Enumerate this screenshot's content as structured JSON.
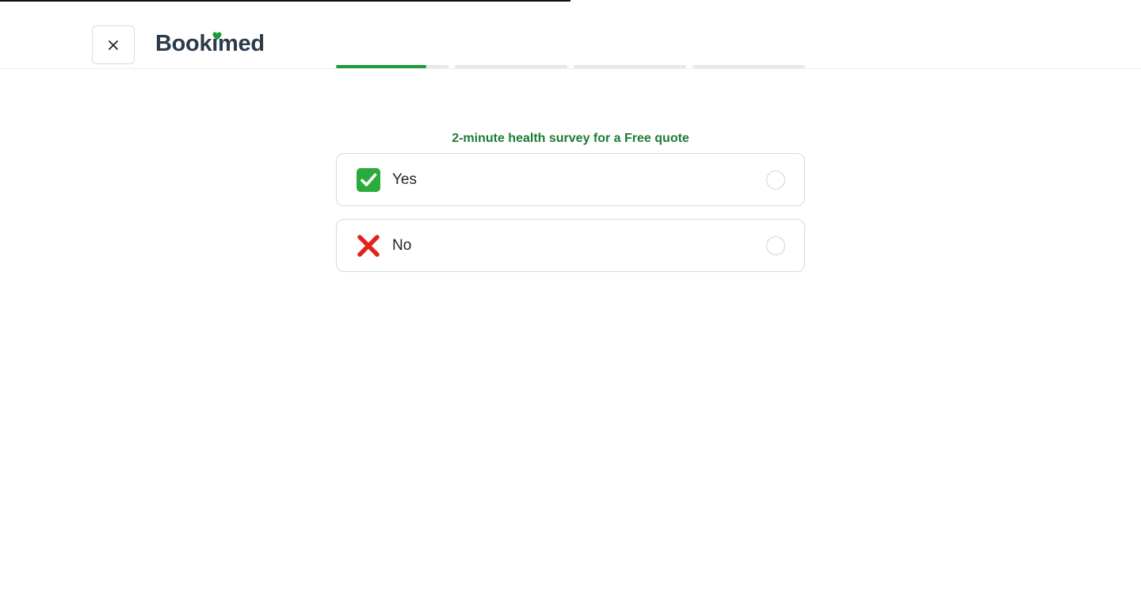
{
  "header": {
    "close_icon": "close-icon",
    "logo_text": "Bookimed",
    "logo_heart_color": "#1e9a3a"
  },
  "progress": {
    "segments": 4,
    "current_fraction": 0.2,
    "fill_color": "#1e9a3a"
  },
  "survey": {
    "title": "2-minute health survey for a Free quote",
    "title_color": "#1d7a33",
    "options": [
      {
        "label": "Yes",
        "icon": "check-mark-icon",
        "selected": false
      },
      {
        "label": "No",
        "icon": "cross-mark-icon",
        "selected": false
      }
    ]
  }
}
